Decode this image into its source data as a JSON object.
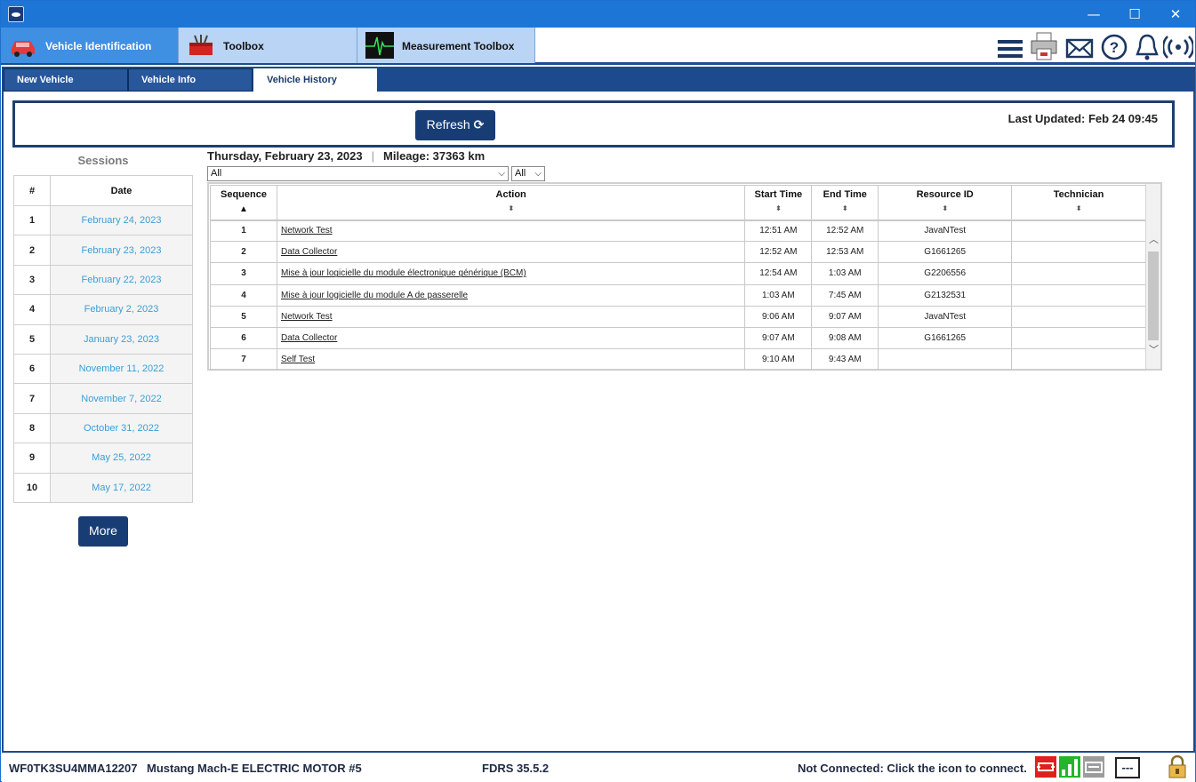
{
  "window": {
    "minimize": "—",
    "maximize": "☐",
    "close": "✕"
  },
  "main_tabs": [
    {
      "label": "Vehicle Identification",
      "icon": "car-icon",
      "active": true
    },
    {
      "label": "Toolbox",
      "icon": "toolbox-icon",
      "active": false
    },
    {
      "label": "Measurement Toolbox",
      "icon": "oscilloscope-icon",
      "active": false
    }
  ],
  "toolbar_icons": [
    "menu-icon",
    "printer-icon",
    "mail-icon",
    "help-icon",
    "bell-icon",
    "wireless-icon"
  ],
  "sub_tabs": [
    {
      "label": "New Vehicle",
      "active": false
    },
    {
      "label": "Vehicle Info",
      "active": false
    },
    {
      "label": "Vehicle History",
      "active": true
    }
  ],
  "top_panel": {
    "refresh_label": "Refresh",
    "last_updated": "Last Updated: Feb 24 09:45"
  },
  "sessions": {
    "title": "Sessions",
    "headers": [
      "#",
      "Date"
    ],
    "rows": [
      {
        "num": "1",
        "date": "February 24, 2023"
      },
      {
        "num": "2",
        "date": "February 23, 2023"
      },
      {
        "num": "3",
        "date": "February 22, 2023"
      },
      {
        "num": "4",
        "date": "February 2, 2023"
      },
      {
        "num": "5",
        "date": "January 23, 2023"
      },
      {
        "num": "6",
        "date": "November 11, 2022"
      },
      {
        "num": "7",
        "date": "November 7, 2022"
      },
      {
        "num": "8",
        "date": "October 31, 2022"
      },
      {
        "num": "9",
        "date": "May 25, 2022"
      },
      {
        "num": "10",
        "date": "May 17, 2022"
      }
    ],
    "more_label": "More"
  },
  "detail": {
    "date": "Thursday, February 23, 2023",
    "separator": "|",
    "mileage": "Mileage: 37363 km",
    "filter_action": "All",
    "filter_second": "All",
    "headers": [
      "Sequence",
      "Action",
      "Start Time",
      "End Time",
      "Resource ID",
      "Technician"
    ],
    "rows": [
      {
        "seq": "1",
        "action": "Network Test",
        "start": "12:51 AM",
        "end": "12:52 AM",
        "resource": "JavaNTest",
        "tech": ""
      },
      {
        "seq": "2",
        "action": "Data Collector",
        "start": "12:52 AM",
        "end": "12:53 AM",
        "resource": "G1661265",
        "tech": ""
      },
      {
        "seq": "3",
        "action": "Mise à jour logicielle du module électronique générique (BCM)",
        "start": "12:54 AM",
        "end": "1:03 AM",
        "resource": "G2206556",
        "tech": ""
      },
      {
        "seq": "4",
        "action": "Mise à jour logicielle du module A de passerelle",
        "start": "1:03 AM",
        "end": "7:45 AM",
        "resource": "G2132531",
        "tech": ""
      },
      {
        "seq": "5",
        "action": "Network Test",
        "start": "9:06 AM",
        "end": "9:07 AM",
        "resource": "JavaNTest",
        "tech": ""
      },
      {
        "seq": "6",
        "action": "Data Collector",
        "start": "9:07 AM",
        "end": "9:08 AM",
        "resource": "G1661265",
        "tech": ""
      },
      {
        "seq": "7",
        "action": "Self Test",
        "start": "9:10 AM",
        "end": "9:43 AM",
        "resource": "",
        "tech": ""
      }
    ]
  },
  "status_bar": {
    "vin": "WF0TK3SU4MMA12207",
    "vehicle": "Mustang Mach-E ELECTRIC MOTOR #5",
    "version": "FDRS 35.5.2",
    "connection": "Not Connected: Click the icon to connect.",
    "dashes": "---",
    "icons": [
      "vci-disconnected-icon",
      "signal-icon",
      "battery-icon",
      "lock-icon"
    ]
  },
  "colors": {
    "accent": "#1d4a8c",
    "active_tab": "#3f8fe2",
    "link": "#3a9fd6"
  }
}
